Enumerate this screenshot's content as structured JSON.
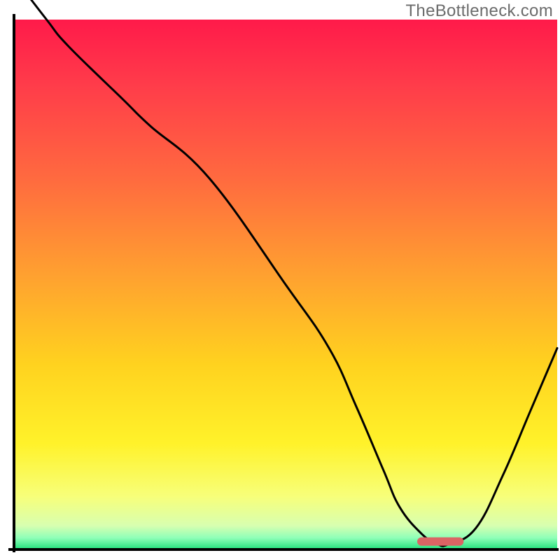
{
  "watermark": "TheBottleneck.com",
  "chart_data": {
    "type": "line",
    "title": "",
    "xlabel": "",
    "ylabel": "",
    "xlim": [
      0,
      100
    ],
    "ylim": [
      0,
      100
    ],
    "x": [
      0,
      6,
      10,
      20,
      25,
      36,
      50,
      58,
      63,
      68,
      71,
      75,
      78,
      80,
      85,
      90,
      95,
      100
    ],
    "y": [
      108,
      100,
      95,
      85,
      80,
      70,
      50,
      38,
      27,
      15,
      8,
      3,
      1,
      1,
      4,
      14,
      26,
      38
    ],
    "marker": {
      "x": [
        75,
        82
      ],
      "y": [
        1.5,
        1.5
      ],
      "color": "#db6464"
    },
    "background_gradient": {
      "stops": [
        {
          "offset": 0.0,
          "color": "#ff1a4a"
        },
        {
          "offset": 0.12,
          "color": "#ff3b4a"
        },
        {
          "offset": 0.3,
          "color": "#ff6a3f"
        },
        {
          "offset": 0.48,
          "color": "#ffa030"
        },
        {
          "offset": 0.65,
          "color": "#ffd21f"
        },
        {
          "offset": 0.8,
          "color": "#fff22a"
        },
        {
          "offset": 0.9,
          "color": "#f7ff7a"
        },
        {
          "offset": 0.955,
          "color": "#d8ffb0"
        },
        {
          "offset": 0.978,
          "color": "#8fffb8"
        },
        {
          "offset": 1.0,
          "color": "#1fe07a"
        }
      ]
    }
  }
}
